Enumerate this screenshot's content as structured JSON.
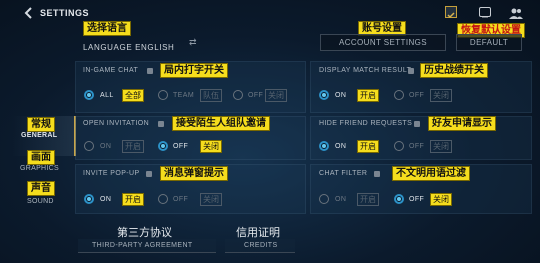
{
  "header": {
    "title": "SETTINGS"
  },
  "top": {
    "language_anno": "选择语言",
    "language_label": "LANGUAGE ENGLISH",
    "account_anno": "账号设置",
    "account_button": "ACCOUNT SETTINGS",
    "restore_anno": "恢复默认设置",
    "default_button": "DEFAULT"
  },
  "sidebar": {
    "general_anno": "常规",
    "general_label": "GENERAL",
    "graphics_anno": "画面",
    "graphics_label": "GRAPHICS",
    "sound_anno": "声音",
    "sound_label": "SOUND"
  },
  "settings": {
    "ingame_chat": {
      "label": "IN-GAME CHAT",
      "anno": "局内打字开关",
      "opt_all": "ALL",
      "opt_all_tag": "全部",
      "opt_team": "TEAM",
      "opt_team_tag": "队伍",
      "opt_off": "OFF",
      "opt_off_tag": "关闭"
    },
    "display_match": {
      "label": "DISPLAY MATCH RESULT",
      "anno": "历史战绩开关",
      "opt_on": "ON",
      "opt_on_tag": "开启",
      "opt_off": "OFF",
      "opt_off_tag": "关闭"
    },
    "open_invitation": {
      "label": "OPEN INVITATION",
      "anno": "接受陌生人组队邀请",
      "opt_on": "ON",
      "opt_on_tag": "开启",
      "opt_off": "OFF",
      "opt_off_tag": "关闭"
    },
    "hide_friend": {
      "label": "HIDE FRIEND REQUESTS",
      "anno": "好友申请显示",
      "opt_on": "ON",
      "opt_on_tag": "开启",
      "opt_off": "OFF",
      "opt_off_tag": "关闭"
    },
    "invite_popup": {
      "label": "INVITE POP-UP",
      "anno": "消息弹窗提示",
      "opt_on": "ON",
      "opt_on_tag": "开启",
      "opt_off": "OFF",
      "opt_off_tag": "关闭"
    },
    "chat_filter": {
      "label": "CHAT FILTER",
      "anno": "不文明用语过滤",
      "opt_on": "ON",
      "opt_on_tag": "开启",
      "opt_off": "OFF",
      "opt_off_tag": "关闭"
    }
  },
  "footer": {
    "third_party_cn": "第三方协议",
    "third_party": "THIRD-PARTY AGREEMENT",
    "credits_cn": "信用证明",
    "credits": "CREDITS"
  }
}
